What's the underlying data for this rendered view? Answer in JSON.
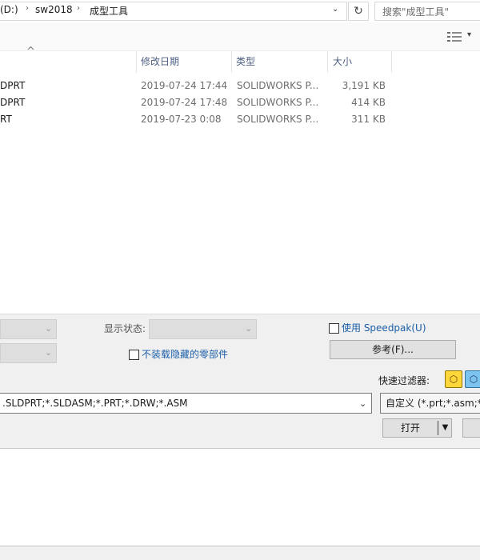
{
  "address": {
    "crumbs": [
      "(D:)",
      "sw2018",
      "成型工具"
    ],
    "separator": "›",
    "dropdown": "⌄",
    "refresh": "↻",
    "search_placeholder": "搜索\"成型工具\""
  },
  "toolbar": {
    "view_dropdown": "▾"
  },
  "columns": {
    "sort_caret": "^",
    "date": "修改日期",
    "type": "类型",
    "size": "大小"
  },
  "files": [
    {
      "name": "DPRT",
      "date": "2019-07-24 17:44",
      "type": "SOLIDWORKS P...",
      "size": "3,191 KB"
    },
    {
      "name": "DPRT",
      "date": "2019-07-24 17:48",
      "type": "SOLIDWORKS P...",
      "size": "414 KB"
    },
    {
      "name": "RT",
      "date": "2019-07-23 0:08",
      "type": "SOLIDWORKS P...",
      "size": "311 KB"
    }
  ],
  "options": {
    "combo_arrow": "⌄",
    "display_state_label": "显示状态:",
    "speedpak_label": "使用 Speedpak(U)",
    "speedpak_checked": false,
    "no_hidden_label": "不装载隐藏的零部件",
    "no_hidden_checked": false,
    "reference_button": "参考(F)...",
    "quick_filter_label": "快速过滤器:",
    "file_type_value": ".SLDPRT;*.SLDASM;*.PRT;*.DRW;*.ASM",
    "file_type_arrow": "⌄",
    "custom_filter_value": "自定义 (*.prt;*.asm;*.d",
    "open_button": "打开",
    "open_split_arrow": "▼"
  },
  "colors": {
    "link": "#1c5fa8",
    "header_text": "#4d6082",
    "filter_part_icon": "#ffd73a",
    "filter_assembly_icon": "#7cc4ef"
  },
  "icons": {
    "view_toggle": "view-details-icon",
    "quick_filter_1": "filter-parts-icon",
    "quick_filter_2": "filter-assemblies-icon"
  }
}
